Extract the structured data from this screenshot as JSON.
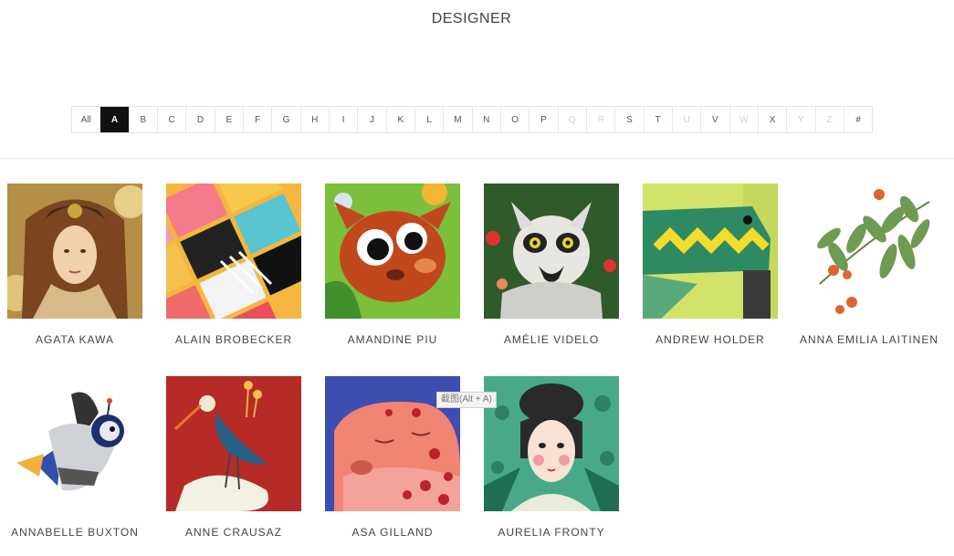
{
  "page_title": "DESIGNER",
  "alphabet": [
    {
      "label": "All",
      "state": "normal"
    },
    {
      "label": "A",
      "state": "active"
    },
    {
      "label": "B",
      "state": "normal"
    },
    {
      "label": "C",
      "state": "normal"
    },
    {
      "label": "D",
      "state": "normal"
    },
    {
      "label": "E",
      "state": "normal"
    },
    {
      "label": "F",
      "state": "normal"
    },
    {
      "label": "G",
      "state": "normal"
    },
    {
      "label": "H",
      "state": "normal"
    },
    {
      "label": "I",
      "state": "normal"
    },
    {
      "label": "J",
      "state": "normal"
    },
    {
      "label": "K",
      "state": "normal"
    },
    {
      "label": "L",
      "state": "normal"
    },
    {
      "label": "M",
      "state": "normal"
    },
    {
      "label": "N",
      "state": "normal"
    },
    {
      "label": "O",
      "state": "normal"
    },
    {
      "label": "P",
      "state": "normal"
    },
    {
      "label": "Q",
      "state": "disabled"
    },
    {
      "label": "R",
      "state": "disabled"
    },
    {
      "label": "S",
      "state": "normal"
    },
    {
      "label": "T",
      "state": "normal"
    },
    {
      "label": "U",
      "state": "disabled"
    },
    {
      "label": "V",
      "state": "normal"
    },
    {
      "label": "W",
      "state": "disabled"
    },
    {
      "label": "X",
      "state": "normal"
    },
    {
      "label": "Y",
      "state": "disabled"
    },
    {
      "label": "Z",
      "state": "disabled"
    },
    {
      "label": "#",
      "state": "normal"
    }
  ],
  "designers": [
    {
      "name": "AGATA KAWA",
      "image": "art-nouveau-woman-portrait"
    },
    {
      "name": "ALAIN BROBECKER",
      "image": "pattern-tiles"
    },
    {
      "name": "AMANDINE PIU",
      "image": "cartoon-fox"
    },
    {
      "name": "AMÉLIE VIDELO",
      "image": "lemur-in-jungle"
    },
    {
      "name": "ANDREW HOLDER",
      "image": "paper-crocodile"
    },
    {
      "name": "ANNA EMILIA LAITINEN",
      "image": "flower-branch"
    },
    {
      "name": "ANNABELLE BUXTON",
      "image": "astronaut-bird"
    },
    {
      "name": "ANNE CRAUSAZ",
      "image": "heron-bird"
    },
    {
      "name": "ASA GILLAND",
      "image": "sleeping-leopard"
    },
    {
      "name": "AURELIA FRONTY",
      "image": "woman-with-bun-hair"
    }
  ],
  "tooltip": "截图(Alt + A)",
  "colors": {
    "active_bg": "#111111",
    "disabled_text": "#d0d0d0"
  }
}
